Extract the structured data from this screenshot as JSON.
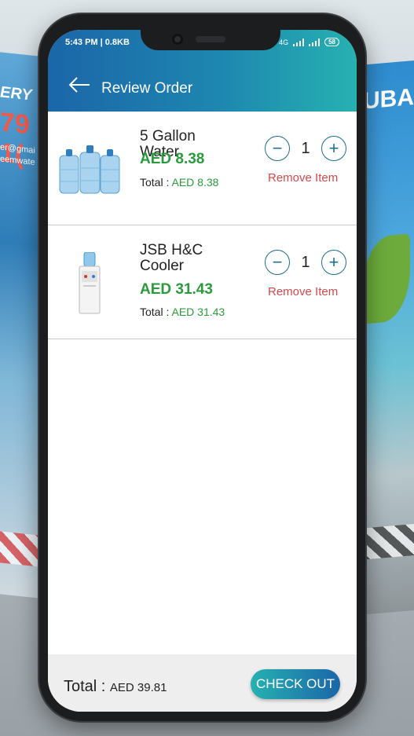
{
  "background": {
    "left_promo": {
      "line1": "ERY",
      "line2": "79 1(",
      "line3": "er@gmai",
      "line4": "eemwate"
    },
    "right_promo": {
      "line1": "DUBA"
    }
  },
  "status_bar": {
    "time": "5:43 PM | 0.8KB",
    "signal": "4G",
    "battery": "58"
  },
  "header": {
    "title": "Review Order",
    "back_icon": "arrow-left-icon"
  },
  "items": [
    {
      "name": "5 Gallon Water",
      "price": "AED 8.38",
      "total_label": "Total :",
      "total_value": "AED 8.38",
      "quantity": "1",
      "remove_label": "Remove Item",
      "image": "water-bottles-image"
    },
    {
      "name": "JSB H&C Cooler",
      "price": "AED 31.43",
      "total_label": "Total :",
      "total_value": "AED 31.43",
      "quantity": "1",
      "remove_label": "Remove Item",
      "image": "water-cooler-image"
    }
  ],
  "footer": {
    "total_label": "Total :",
    "total_value": "AED 39.81",
    "checkout_label": "CHECK OUT"
  },
  "colors": {
    "header_start": "#1b66a8",
    "header_end": "#26b1b1",
    "price_green": "#2a9b3c",
    "remove_red": "#d44949"
  }
}
